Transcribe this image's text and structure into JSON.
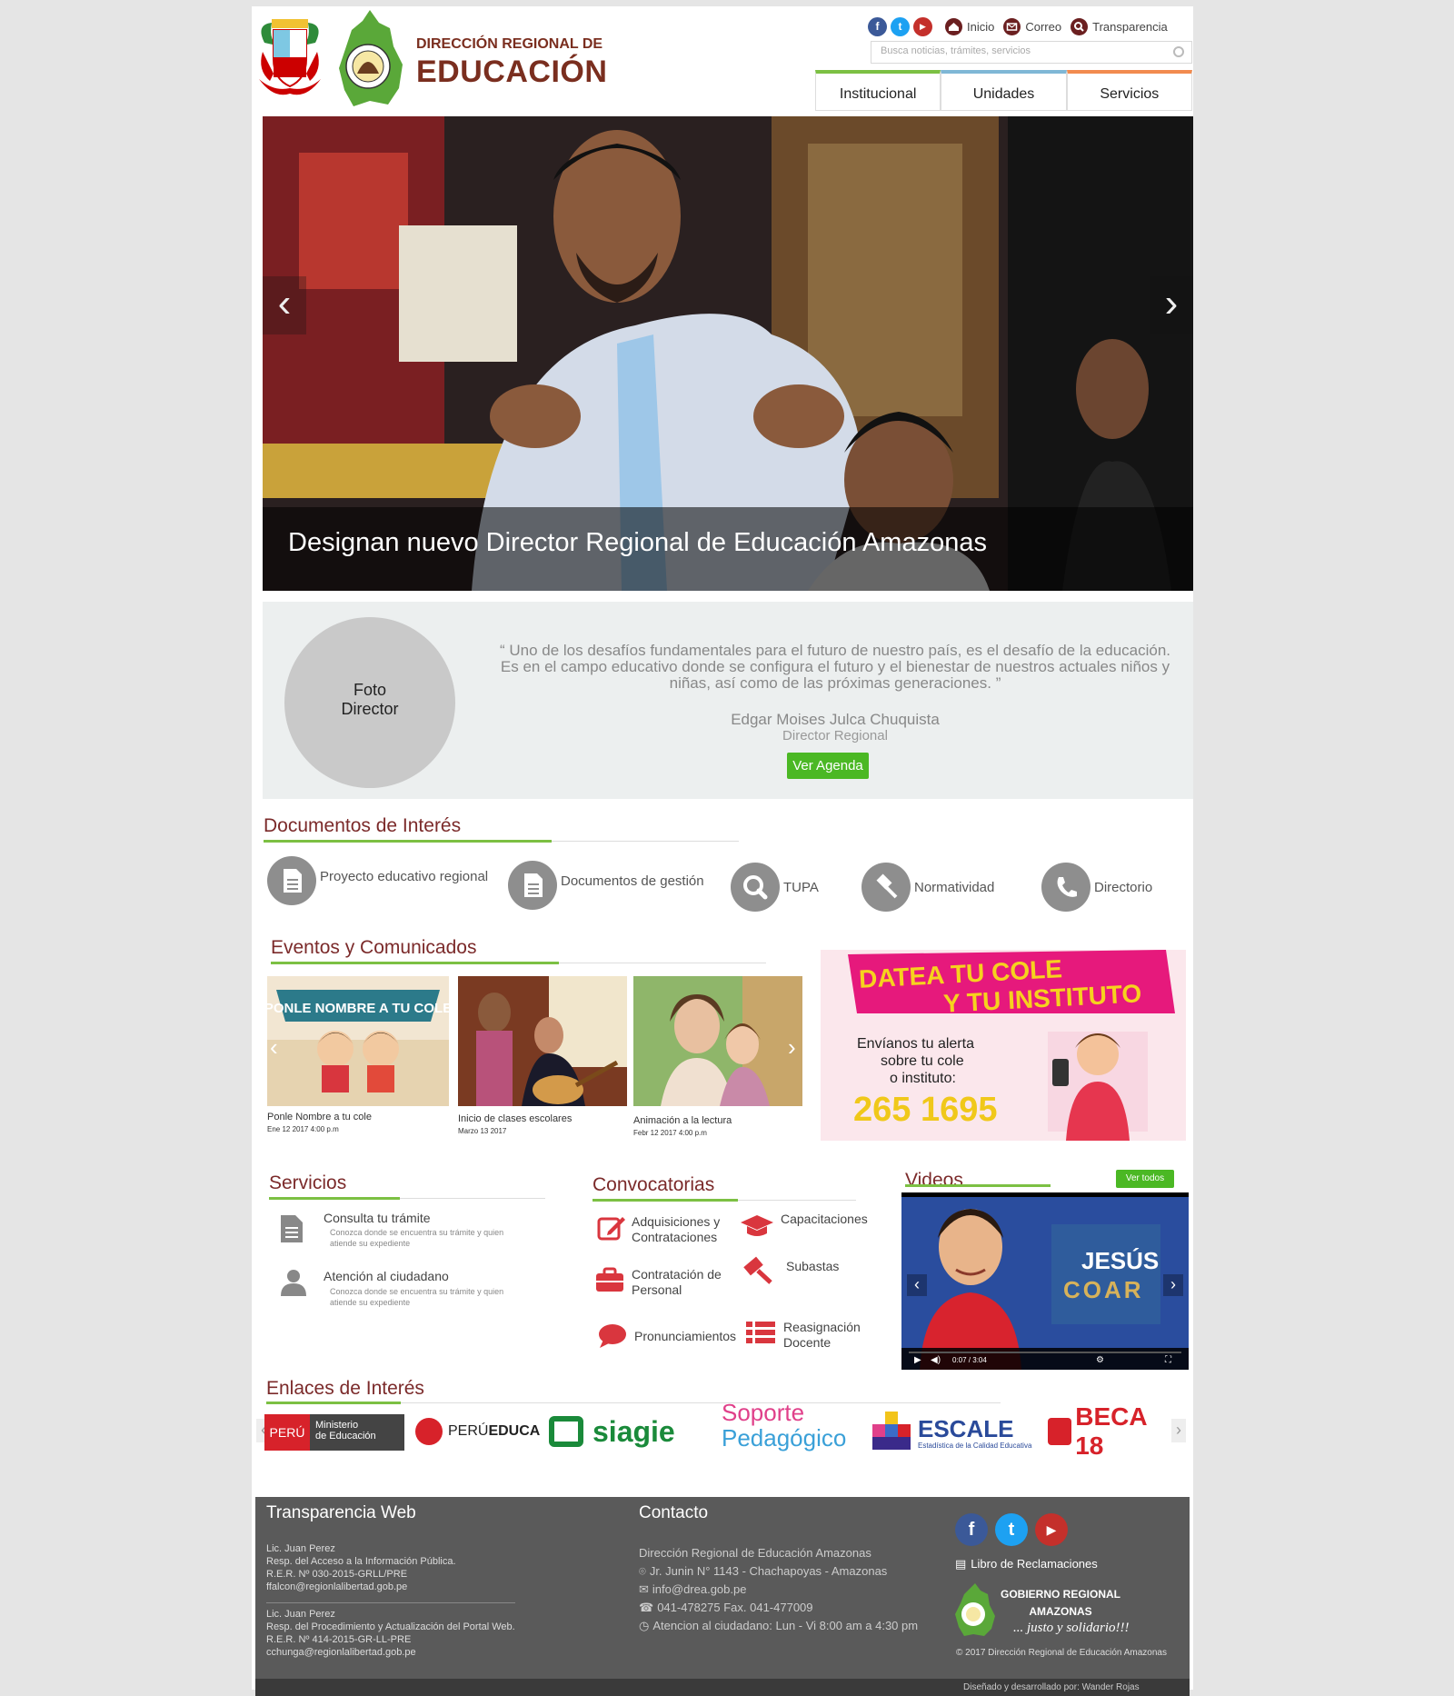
{
  "header": {
    "org_line1": "DIRECCIÓN REGIONAL DE",
    "org_line2": "EDUCACIÓN",
    "links": {
      "inicio": "Inicio",
      "correo": "Correo",
      "transparencia": "Transparencia"
    },
    "search_placeholder": "Busca noticias, trámites, servicios",
    "tabs": [
      {
        "label": "Institucional",
        "color": "#7cc043"
      },
      {
        "label": "Unidades",
        "color": "#7fb7d6"
      },
      {
        "label": "Servicios",
        "color": "#f28b4f"
      }
    ]
  },
  "slider": {
    "caption": "Designan nuevo Director Regional de Educación Amazonas"
  },
  "director": {
    "photo_label": "Foto\nDirector",
    "quote": "“ Uno de los desafíos fundamentales para el futuro de nuestro país, es el desafío de la educación.  Es en el campo educativo donde se configura el futuro y el bienestar de nuestros actuales niños y niñas, así como de las próximas generaciones. ”",
    "name": "Edgar Moises Julca Chuquista",
    "role": "Director Regional",
    "agenda_button": "Ver Agenda"
  },
  "documentos": {
    "title": "Documentos de Interés",
    "items": [
      {
        "label": "Proyecto educativo regional",
        "icon": "document-icon"
      },
      {
        "label": "Documentos de gestión",
        "icon": "document-icon"
      },
      {
        "label": "TUPA",
        "icon": "search-icon"
      },
      {
        "label": "Normatividad",
        "icon": "gavel-icon"
      },
      {
        "label": "Directorio",
        "icon": "phone-icon"
      }
    ]
  },
  "eventos": {
    "title": "Eventos y Comunicados",
    "items": [
      {
        "title": "Ponle Nombre a tu cole",
        "date": "Ene 12 2017 4:00 p.m",
        "banner": "PONLE NOMBRE A TU COLE"
      },
      {
        "title": "Inicio de clases escolares",
        "date": "Marzo 13 2017"
      },
      {
        "title": "Animación a la lectura",
        "date": "Febr 12 2017 4:00 p.m"
      }
    ]
  },
  "promo": {
    "title1": "DATEA TU COLE",
    "title2": "Y TU INSTITUTO",
    "text1": "Envíanos tu alerta",
    "text2": "sobre tu cole",
    "text3": "o instituto:",
    "number": "265 1695"
  },
  "servicios": {
    "title": "Servicios",
    "items": [
      {
        "title": "Consulta tu trámite",
        "desc": "Conozca donde se encuentra su trámite y quien atiende su expediente"
      },
      {
        "title": "Atención al ciudadano",
        "desc": "Conozca donde se encuentra su trámite y quien atiende su expediente"
      }
    ]
  },
  "convocatorias": {
    "title": "Convocatorias",
    "items": [
      {
        "label": "Adquisiciones y Contrataciones",
        "icon": "edit-icon"
      },
      {
        "label": "Capacitaciones",
        "icon": "graduation-cap-icon"
      },
      {
        "label": "Contratación de Personal",
        "icon": "briefcase-icon"
      },
      {
        "label": "Subastas",
        "icon": "gavel-icon"
      },
      {
        "label": "Pronunciamientos",
        "icon": "speech-bubble-icon"
      },
      {
        "label": "Reasignación Docente",
        "icon": "list-icon"
      }
    ],
    "accent": "#d9363e"
  },
  "videos": {
    "title": "Videos",
    "button": "Ver todos",
    "brand1": "JESÚS",
    "brand2": "COAR",
    "time": "0:07 / 3:04"
  },
  "enlaces": {
    "title": "Enlaces de Interés",
    "logos": [
      {
        "name": "minedu",
        "a": "PERÚ",
        "b": "Ministerio",
        "c": "de Educación"
      },
      {
        "name": "perueduca",
        "a": "PERÚ",
        "b": "EDUCA"
      },
      {
        "name": "siagie",
        "a": "siagie"
      },
      {
        "name": "soporte",
        "a": "Soporte",
        "b": "Pedagógico"
      },
      {
        "name": "escale",
        "a": "ESCALE",
        "b": "Estadística de la Calidad Educativa"
      },
      {
        "name": "beca18",
        "a": "BECA 18"
      }
    ]
  },
  "footer": {
    "transparencia_title": "Transparencia Web",
    "block1": [
      "Lic. Juan Perez",
      "Resp. del Acceso a la Información Pública.",
      "R.E.R. Nº 030-2015-GRLL/PRE",
      "ffalcon@regionlalibertad.gob.pe"
    ],
    "block2": [
      "Lic. Juan Perez",
      "Resp. del Procedimiento y Actualización del Portal Web.",
      "R.E.R. Nº 414-2015-GR-LL-PRE",
      "cchunga@regionlalibertad.gob.pe"
    ],
    "contacto_title": "Contacto",
    "contacto": {
      "org": "Dirección Regional de Educación Amazonas",
      "address": "Jr. Junin N° 1143 - Chachapoyas - Amazonas",
      "email": "info@drea.gob.pe",
      "phone": "041-478275  Fax. 041-477009",
      "hours": "Atencion al ciudadano: Lun - Vi 8:00 am a 4:30 pm"
    },
    "libro": "Libro de Reclamaciones",
    "gobierno1": "GOBIERNO REGIONAL",
    "gobierno2": "AMAZONAS",
    "slogan": "... justo y solidario!!!",
    "copyright": "© 2017 Dirección Regional de Educación Amazonas",
    "designed": "Diseñado y desarrollado por: Wander Rojas"
  },
  "colors": {
    "accent_green": "#7cc043",
    "brand_maroon": "#7a2e1f",
    "button_green": "#4bb824"
  }
}
